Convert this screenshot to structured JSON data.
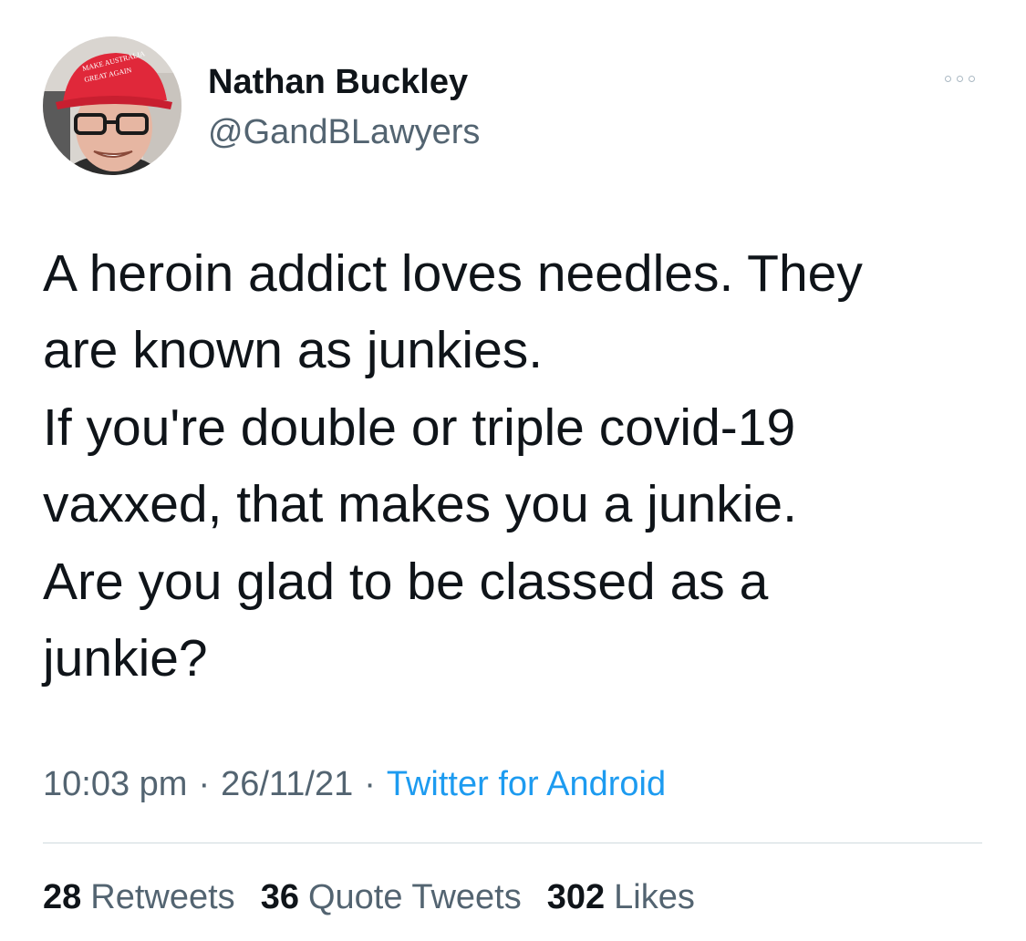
{
  "author": {
    "name": "Nathan Buckley",
    "handle": "@GandBLawyers",
    "avatar_icon": "profile-photo-red-cap",
    "cap_text_line1": "MAKE AUSTRALIA",
    "cap_text_line2": "GREAT AGAIN"
  },
  "more_icon": "ellipsis-icon",
  "tweet": {
    "lines": [
      "A heroin addict loves needles. They",
      "are known as junkies.",
      "If you're double or triple covid-19",
      "vaxxed, that makes you a junkie.",
      "Are you glad to be classed as a",
      "junkie?"
    ]
  },
  "meta": {
    "time": "10:03 pm",
    "separator": "·",
    "date": "26/11/21",
    "source": "Twitter for Android"
  },
  "stats": {
    "retweets_count": "28",
    "retweets_label": "Retweets",
    "quotes_count": "36",
    "quotes_label": "Quote Tweets",
    "likes_count": "302",
    "likes_label": "Likes"
  },
  "colors": {
    "text": "#0f1419",
    "secondary": "#536471",
    "link": "#1d9bf0",
    "divider": "#cfd9de",
    "cap": "#e0283a"
  }
}
